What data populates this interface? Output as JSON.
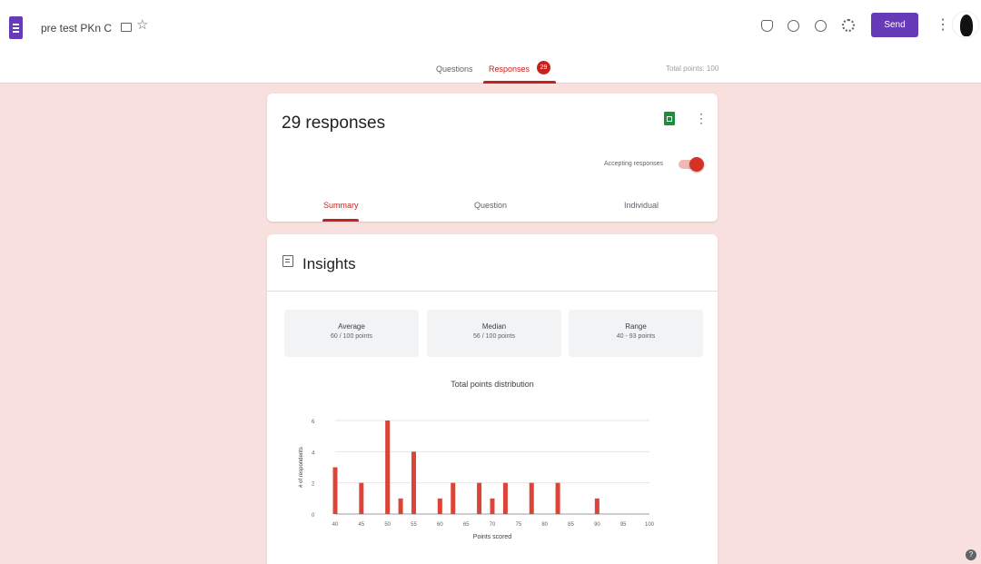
{
  "header": {
    "doc_title": "pre test PKn C",
    "send_label": "Send",
    "tabs": [
      {
        "label": "Questions"
      },
      {
        "label": "Responses",
        "badge": "29"
      }
    ],
    "total_points": "Total points: 100",
    "accent_color": "#673ab7"
  },
  "responses_card": {
    "title": "29 responses",
    "accepting_label": "Accepting responses",
    "accepting": true,
    "tabs": [
      "Summary",
      "Question",
      "Individual"
    ],
    "active_tab": "Summary"
  },
  "insights": {
    "title": "Insights",
    "stats": {
      "average": {
        "label": "Average",
        "value": "60 / 100 points"
      },
      "median": {
        "label": "Median",
        "value": "56 / 100 points"
      },
      "range": {
        "label": "Range",
        "value": "40 - 93 points"
      }
    }
  },
  "chart_data": {
    "type": "bar",
    "title": "Total points distribution",
    "xlabel": "Points scored",
    "ylabel": "# of respondents",
    "x": [
      40,
      45,
      50,
      55,
      60,
      65,
      70,
      75,
      80,
      85,
      90,
      95,
      100
    ],
    "x_ticks": [
      "40",
      "45",
      "50",
      "55",
      "60",
      "65",
      "70",
      "75",
      "80",
      "85",
      "90",
      "95",
      "100"
    ],
    "y_ticks": [
      "0",
      "2",
      "4",
      "6"
    ],
    "ylim": [
      0,
      6
    ],
    "bars": [
      {
        "x": 40,
        "value": 3
      },
      {
        "x": 45,
        "value": 2
      },
      {
        "x": 50,
        "value": 6
      },
      {
        "x": 52.5,
        "value": 1
      },
      {
        "x": 55,
        "value": 4
      },
      {
        "x": 60,
        "value": 1
      },
      {
        "x": 62.5,
        "value": 2
      },
      {
        "x": 67.5,
        "value": 2
      },
      {
        "x": 70,
        "value": 1
      },
      {
        "x": 72.5,
        "value": 2
      },
      {
        "x": 77.5,
        "value": 2
      },
      {
        "x": 82.5,
        "value": 2
      },
      {
        "x": 90,
        "value": 1
      }
    ],
    "bar_color": "#db4437",
    "grid": true
  }
}
